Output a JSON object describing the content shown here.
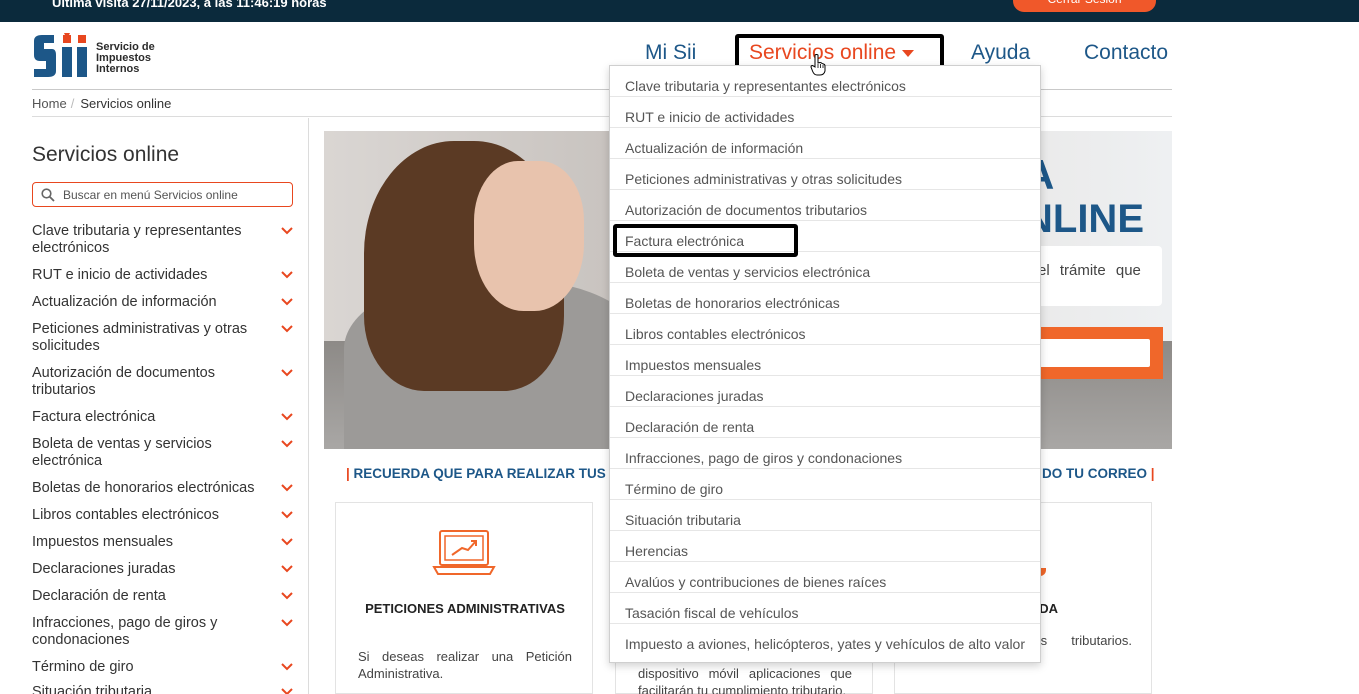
{
  "topbar": {
    "last_visit": "Ultima visita 27/11/2023, a las 11:46:19 horas",
    "logout_label": "Cerrar Sesión"
  },
  "logo": {
    "line1": "Servicio de",
    "line2": "Impuestos",
    "line3": "Internos"
  },
  "nav": {
    "mi_sii": "Mi Sii",
    "servicios": "Servicios online",
    "ayuda": "Ayuda",
    "contacto": "Contacto"
  },
  "breadcrumb": {
    "home": "Home",
    "sep": "/",
    "current": "Servicios online"
  },
  "sidebar": {
    "title": "Servicios online",
    "search_placeholder": "Buscar en menú Servicios online",
    "items": [
      {
        "label": "Clave tributaria y representantes electrónicos"
      },
      {
        "label": "RUT e inicio de actividades"
      },
      {
        "label": "Actualización de información"
      },
      {
        "label": "Peticiones administrativas y otras solicitudes"
      },
      {
        "label": "Autorización de documentos tributarios"
      },
      {
        "label": "Factura electrónica"
      },
      {
        "label": "Boleta de ventas y servicios electrónica"
      },
      {
        "label": "Boletas de honorarios electrónicas"
      },
      {
        "label": "Libros contables electrónicos"
      },
      {
        "label": "Impuestos mensuales"
      },
      {
        "label": "Declaraciones juradas"
      },
      {
        "label": "Declaración de renta"
      },
      {
        "label": "Infracciones, pago de giros y condonaciones"
      },
      {
        "label": "Término de giro"
      },
      {
        "label": "Situación tributaria"
      }
    ]
  },
  "hero": {
    "title_a": "A",
    "title_b": "NLINE",
    "text": "el trámite que"
  },
  "reminder": {
    "left": "RECUERDA QUE PARA REALIZAR TUS T",
    "right": "DO TU CORREO",
    "bar": "|"
  },
  "cards": {
    "c1": {
      "title": "PETICIONES ADMINISTRATIVAS",
      "text": "Si deseas realizar una Petición Administrativa."
    },
    "c2": {
      "text": "dispositivo móvil aplicaciones que facilitarán tu cumplimiento tributario."
    },
    "c3": {
      "title": "AYUDA",
      "text": "sobre fechas, s tributarios. CONTÁCTANOS:"
    }
  },
  "dropdown": {
    "items": [
      {
        "label": "Clave tributaria y representantes electrónicos"
      },
      {
        "label": "RUT e inicio de actividades"
      },
      {
        "label": "Actualización de información"
      },
      {
        "label": "Peticiones administrativas y otras solicitudes"
      },
      {
        "label": "Autorización de documentos tributarios"
      },
      {
        "label": "Factura electrónica"
      },
      {
        "label": "Boleta de ventas y servicios electrónica"
      },
      {
        "label": "Boletas de honorarios electrónicas"
      },
      {
        "label": "Libros contables electrónicos"
      },
      {
        "label": "Impuestos mensuales"
      },
      {
        "label": "Declaraciones juradas"
      },
      {
        "label": "Declaración de renta"
      },
      {
        "label": "Infracciones, pago de giros y condonaciones"
      },
      {
        "label": "Término de giro"
      },
      {
        "label": "Situación tributaria"
      },
      {
        "label": "Herencias"
      },
      {
        "label": "Avalúos y contribuciones de bienes raíces"
      },
      {
        "label": "Tasación fiscal de vehículos"
      },
      {
        "label": "Impuesto a aviones, helicópteros, yates y vehículos de alto valor"
      }
    ]
  },
  "colors": {
    "brand_blue": "#1d5788",
    "accent_orange": "#e8471f",
    "topbar": "#0b2a3c"
  }
}
